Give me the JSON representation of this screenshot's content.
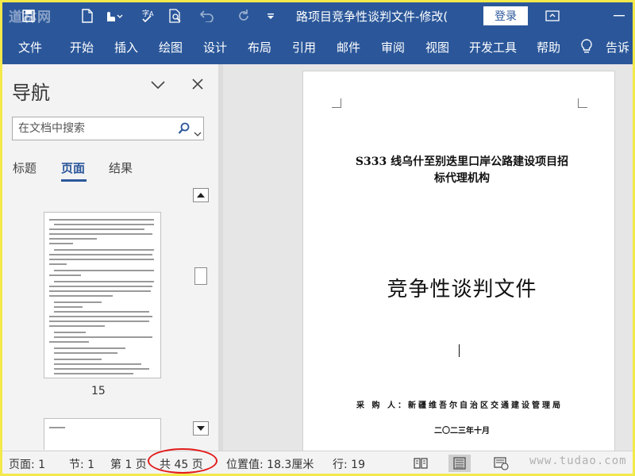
{
  "titlebar": {
    "watermark": "道林网",
    "doc_title": "路项目竞争性谈判文件-修改(",
    "login_label": "登录"
  },
  "ribbon": {
    "tabs": [
      "文件",
      "开始",
      "插入",
      "绘图",
      "设计",
      "布局",
      "引用",
      "邮件",
      "审阅",
      "视图",
      "开发工具",
      "帮助",
      "告诉"
    ]
  },
  "nav": {
    "title": "导航",
    "search_placeholder": "在文档中搜索",
    "tabs": [
      "标题",
      "页面",
      "结果"
    ],
    "active_tab": "页面",
    "thumbnail_page": "15"
  },
  "document": {
    "heading_line1": "S333 线乌什至别迭里口岸公路建设项目招",
    "heading_line2": "标代理机构",
    "big_title": "竞争性谈判文件",
    "buyer": "采 购 人：新疆维吾尔自治区交通建设管理局",
    "date": "二〇二三年十月"
  },
  "status": {
    "page": "页面: 1",
    "section": "节: 1",
    "page_of": "第 1 页",
    "total_pages": "共 45 页",
    "position": "位置值: 18.3厘米",
    "line": "行: 19",
    "watermark": "www.tudao.com"
  },
  "colors": {
    "ribbon_blue": "#2b579a",
    "highlight_red": "#e21b1b",
    "outer_border_yellow": "#f3e94a"
  }
}
